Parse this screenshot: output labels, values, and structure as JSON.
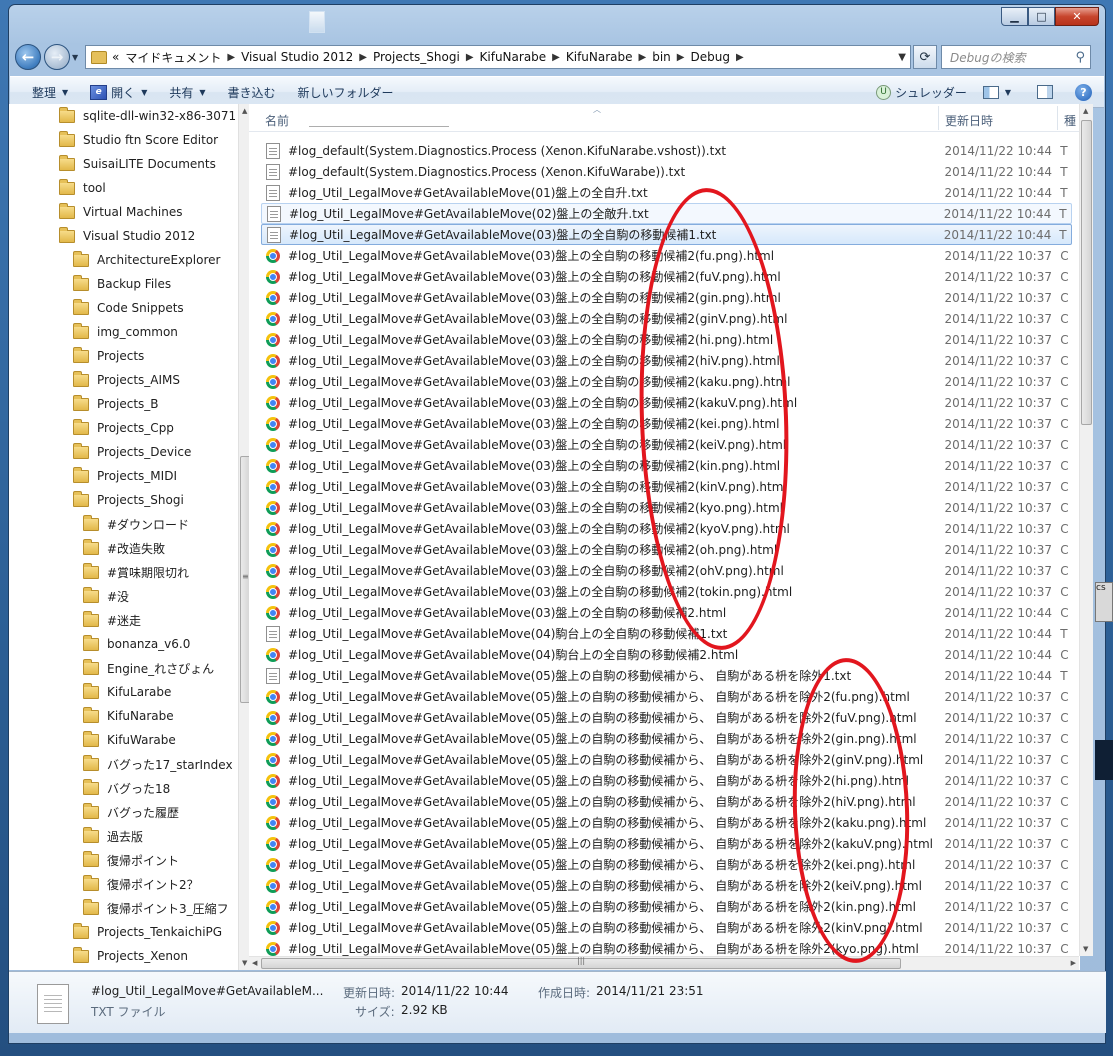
{
  "address": {
    "crumbs": [
      "マイドキュメント",
      "Visual Studio 2012",
      "Projects_Shogi",
      "KifuNarabe",
      "KifuNarabe",
      "bin",
      "Debug"
    ],
    "prefix": "«"
  },
  "search": {
    "placeholder": "Debugの検索"
  },
  "toolbar": {
    "organize": "整理",
    "open": "開く",
    "share": "共有",
    "burn": "書き込む",
    "new_folder": "新しいフォルダー",
    "shredder": "シュレッダー"
  },
  "nav_tree": [
    {
      "label": "sqlite-dll-win32-x86-3071",
      "level": 1
    },
    {
      "label": "Studio ftn Score Editor",
      "level": 1
    },
    {
      "label": "SuisaiLITE Documents",
      "level": 1
    },
    {
      "label": "tool",
      "level": 1
    },
    {
      "label": "Virtual Machines",
      "level": 1
    },
    {
      "label": "Visual Studio 2012",
      "level": 1
    },
    {
      "label": "ArchitectureExplorer",
      "level": 2
    },
    {
      "label": "Backup Files",
      "level": 2
    },
    {
      "label": "Code Snippets",
      "level": 2
    },
    {
      "label": "img_common",
      "level": 2
    },
    {
      "label": "Projects",
      "level": 2
    },
    {
      "label": "Projects_AIMS",
      "level": 2
    },
    {
      "label": "Projects_B",
      "level": 2
    },
    {
      "label": "Projects_Cpp",
      "level": 2
    },
    {
      "label": "Projects_Device",
      "level": 2
    },
    {
      "label": "Projects_MIDI",
      "level": 2
    },
    {
      "label": "Projects_Shogi",
      "level": 2
    },
    {
      "label": "#ダウンロード",
      "level": 3
    },
    {
      "label": "#改造失敗",
      "level": 3
    },
    {
      "label": "#賞味期限切れ",
      "level": 3
    },
    {
      "label": "#没",
      "level": 3
    },
    {
      "label": "#迷走",
      "level": 3
    },
    {
      "label": "bonanza_v6.0",
      "level": 3
    },
    {
      "label": "Engine_れさぴょん",
      "level": 3
    },
    {
      "label": "KifuLarabe",
      "level": 3
    },
    {
      "label": "KifuNarabe",
      "level": 3
    },
    {
      "label": "KifuWarabe",
      "level": 3
    },
    {
      "label": "バグった17_starIndex",
      "level": 3
    },
    {
      "label": "バグった18",
      "level": 3
    },
    {
      "label": "バグった履歴",
      "level": 3
    },
    {
      "label": "過去版",
      "level": 3
    },
    {
      "label": "復帰ポイント",
      "level": 3
    },
    {
      "label": "復帰ポイント2？",
      "level": 3
    },
    {
      "label": "復帰ポイント3_圧縮フ",
      "level": 3
    },
    {
      "label": "Projects_TenkaichiPG",
      "level": 2
    },
    {
      "label": "Projects_Xenon",
      "level": 2
    }
  ],
  "columns": {
    "name": "名前",
    "modified": "更新日時",
    "type": "種"
  },
  "files": [
    {
      "name": "#log_default(System.Diagnostics.Process (Xenon.KifuNarabe.vshost)).txt",
      "date": "2014/11/22 10:44",
      "type": "T",
      "icon": "text-file-icon"
    },
    {
      "name": "#log_default(System.Diagnostics.Process (Xenon.KifuWarabe)).txt",
      "date": "2014/11/22 10:44",
      "type": "T",
      "icon": "text-file-icon"
    },
    {
      "name": "#log_Util_LegalMove#GetAvailableMove(01)盤上の全自升.txt",
      "date": "2014/11/22 10:44",
      "type": "T",
      "icon": "text-file-icon"
    },
    {
      "name": "#log_Util_LegalMove#GetAvailableMove(02)盤上の全敵升.txt",
      "date": "2014/11/22 10:44",
      "type": "T",
      "icon": "text-file-icon",
      "state": "hover"
    },
    {
      "name": "#log_Util_LegalMove#GetAvailableMove(03)盤上の全自駒の移動候補1.txt",
      "date": "2014/11/22 10:44",
      "type": "T",
      "icon": "text-file-icon",
      "state": "selected"
    },
    {
      "name": "#log_Util_LegalMove#GetAvailableMove(03)盤上の全自駒の移動候補2(fu.png).html",
      "date": "2014/11/22 10:37",
      "type": "C",
      "icon": "chrome-html-icon"
    },
    {
      "name": "#log_Util_LegalMove#GetAvailableMove(03)盤上の全自駒の移動候補2(fuV.png).html",
      "date": "2014/11/22 10:37",
      "type": "C",
      "icon": "chrome-html-icon"
    },
    {
      "name": "#log_Util_LegalMove#GetAvailableMove(03)盤上の全自駒の移動候補2(gin.png).html",
      "date": "2014/11/22 10:37",
      "type": "C",
      "icon": "chrome-html-icon"
    },
    {
      "name": "#log_Util_LegalMove#GetAvailableMove(03)盤上の全自駒の移動候補2(ginV.png).html",
      "date": "2014/11/22 10:37",
      "type": "C",
      "icon": "chrome-html-icon"
    },
    {
      "name": "#log_Util_LegalMove#GetAvailableMove(03)盤上の全自駒の移動候補2(hi.png).html",
      "date": "2014/11/22 10:37",
      "type": "C",
      "icon": "chrome-html-icon"
    },
    {
      "name": "#log_Util_LegalMove#GetAvailableMove(03)盤上の全自駒の移動候補2(hiV.png).html",
      "date": "2014/11/22 10:37",
      "type": "C",
      "icon": "chrome-html-icon"
    },
    {
      "name": "#log_Util_LegalMove#GetAvailableMove(03)盤上の全自駒の移動候補2(kaku.png).html",
      "date": "2014/11/22 10:37",
      "type": "C",
      "icon": "chrome-html-icon"
    },
    {
      "name": "#log_Util_LegalMove#GetAvailableMove(03)盤上の全自駒の移動候補2(kakuV.png).html",
      "date": "2014/11/22 10:37",
      "type": "C",
      "icon": "chrome-html-icon"
    },
    {
      "name": "#log_Util_LegalMove#GetAvailableMove(03)盤上の全自駒の移動候補2(kei.png).html",
      "date": "2014/11/22 10:37",
      "type": "C",
      "icon": "chrome-html-icon"
    },
    {
      "name": "#log_Util_LegalMove#GetAvailableMove(03)盤上の全自駒の移動候補2(keiV.png).html",
      "date": "2014/11/22 10:37",
      "type": "C",
      "icon": "chrome-html-icon"
    },
    {
      "name": "#log_Util_LegalMove#GetAvailableMove(03)盤上の全自駒の移動候補2(kin.png).html",
      "date": "2014/11/22 10:37",
      "type": "C",
      "icon": "chrome-html-icon"
    },
    {
      "name": "#log_Util_LegalMove#GetAvailableMove(03)盤上の全自駒の移動候補2(kinV.png).html",
      "date": "2014/11/22 10:37",
      "type": "C",
      "icon": "chrome-html-icon"
    },
    {
      "name": "#log_Util_LegalMove#GetAvailableMove(03)盤上の全自駒の移動候補2(kyo.png).html",
      "date": "2014/11/22 10:37",
      "type": "C",
      "icon": "chrome-html-icon"
    },
    {
      "name": "#log_Util_LegalMove#GetAvailableMove(03)盤上の全自駒の移動候補2(kyoV.png).html",
      "date": "2014/11/22 10:37",
      "type": "C",
      "icon": "chrome-html-icon"
    },
    {
      "name": "#log_Util_LegalMove#GetAvailableMove(03)盤上の全自駒の移動候補2(oh.png).html",
      "date": "2014/11/22 10:37",
      "type": "C",
      "icon": "chrome-html-icon"
    },
    {
      "name": "#log_Util_LegalMove#GetAvailableMove(03)盤上の全自駒の移動候補2(ohV.png).html",
      "date": "2014/11/22 10:37",
      "type": "C",
      "icon": "chrome-html-icon"
    },
    {
      "name": "#log_Util_LegalMove#GetAvailableMove(03)盤上の全自駒の移動候補2(tokin.png).html",
      "date": "2014/11/22 10:37",
      "type": "C",
      "icon": "chrome-html-icon"
    },
    {
      "name": "#log_Util_LegalMove#GetAvailableMove(03)盤上の全自駒の移動候補2.html",
      "date": "2014/11/22 10:44",
      "type": "C",
      "icon": "chrome-html-icon"
    },
    {
      "name": "#log_Util_LegalMove#GetAvailableMove(04)駒台上の全自駒の移動候補1.txt",
      "date": "2014/11/22 10:44",
      "type": "T",
      "icon": "text-file-icon"
    },
    {
      "name": "#log_Util_LegalMove#GetAvailableMove(04)駒台上の全自駒の移動候補2.html",
      "date": "2014/11/22 10:44",
      "type": "C",
      "icon": "chrome-html-icon"
    },
    {
      "name": "#log_Util_LegalMove#GetAvailableMove(05)盤上の自駒の移動候補から、 自駒がある枡を除外1.txt",
      "date": "2014/11/22 10:44",
      "type": "T",
      "icon": "text-file-icon"
    },
    {
      "name": "#log_Util_LegalMove#GetAvailableMove(05)盤上の自駒の移動候補から、 自駒がある枡を除外2(fu.png).html",
      "date": "2014/11/22 10:37",
      "type": "C",
      "icon": "chrome-html-icon"
    },
    {
      "name": "#log_Util_LegalMove#GetAvailableMove(05)盤上の自駒の移動候補から、 自駒がある枡を除外2(fuV.png).html",
      "date": "2014/11/22 10:37",
      "type": "C",
      "icon": "chrome-html-icon"
    },
    {
      "name": "#log_Util_LegalMove#GetAvailableMove(05)盤上の自駒の移動候補から、 自駒がある枡を除外2(gin.png).html",
      "date": "2014/11/22 10:37",
      "type": "C",
      "icon": "chrome-html-icon"
    },
    {
      "name": "#log_Util_LegalMove#GetAvailableMove(05)盤上の自駒の移動候補から、 自駒がある枡を除外2(ginV.png).html",
      "date": "2014/11/22 10:37",
      "type": "C",
      "icon": "chrome-html-icon"
    },
    {
      "name": "#log_Util_LegalMove#GetAvailableMove(05)盤上の自駒の移動候補から、 自駒がある枡を除外2(hi.png).html",
      "date": "2014/11/22 10:37",
      "type": "C",
      "icon": "chrome-html-icon"
    },
    {
      "name": "#log_Util_LegalMove#GetAvailableMove(05)盤上の自駒の移動候補から、 自駒がある枡を除外2(hiV.png).html",
      "date": "2014/11/22 10:37",
      "type": "C",
      "icon": "chrome-html-icon"
    },
    {
      "name": "#log_Util_LegalMove#GetAvailableMove(05)盤上の自駒の移動候補から、 自駒がある枡を除外2(kaku.png).html",
      "date": "2014/11/22 10:37",
      "type": "C",
      "icon": "chrome-html-icon"
    },
    {
      "name": "#log_Util_LegalMove#GetAvailableMove(05)盤上の自駒の移動候補から、 自駒がある枡を除外2(kakuV.png).html",
      "date": "2014/11/22 10:37",
      "type": "C",
      "icon": "chrome-html-icon"
    },
    {
      "name": "#log_Util_LegalMove#GetAvailableMove(05)盤上の自駒の移動候補から、 自駒がある枡を除外2(kei.png).html",
      "date": "2014/11/22 10:37",
      "type": "C",
      "icon": "chrome-html-icon"
    },
    {
      "name": "#log_Util_LegalMove#GetAvailableMove(05)盤上の自駒の移動候補から、 自駒がある枡を除外2(keiV.png).html",
      "date": "2014/11/22 10:37",
      "type": "C",
      "icon": "chrome-html-icon"
    },
    {
      "name": "#log_Util_LegalMove#GetAvailableMove(05)盤上の自駒の移動候補から、 自駒がある枡を除外2(kin.png).html",
      "date": "2014/11/22 10:37",
      "type": "C",
      "icon": "chrome-html-icon"
    },
    {
      "name": "#log_Util_LegalMove#GetAvailableMove(05)盤上の自駒の移動候補から、 自駒がある枡を除外2(kinV.png).html",
      "date": "2014/11/22 10:37",
      "type": "C",
      "icon": "chrome-html-icon"
    },
    {
      "name": "#log_Util_LegalMove#GetAvailableMove(05)盤上の自駒の移動候補から、 自駒がある枡を除外2(kyo.png).html",
      "date": "2014/11/22 10:37",
      "type": "C",
      "icon": "chrome-html-icon"
    }
  ],
  "details": {
    "name": "#log_Util_LegalMove#GetAvailableM...",
    "kind": "TXT ファイル",
    "modified_label": "更新日時:",
    "modified_value": "2014/11/22 10:44",
    "created_label": "作成日時:",
    "created_value": "2014/11/21 23:51",
    "size_label": "サイズ:",
    "size_value": "2.92 KB"
  },
  "side_fragment": "cs",
  "colors": {
    "annotation": "#e2161e",
    "selection_border": "#84acdd",
    "window_frame": "#a8c4e2"
  }
}
